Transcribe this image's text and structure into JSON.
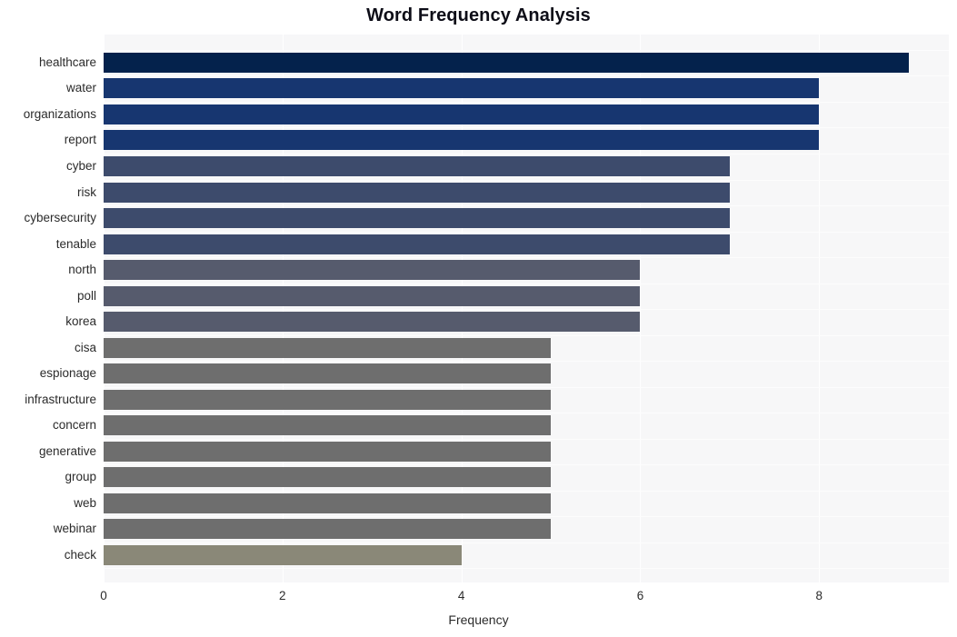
{
  "chart_data": {
    "type": "bar",
    "orientation": "horizontal",
    "title": "Word Frequency Analysis",
    "xlabel": "Frequency",
    "ylabel": "",
    "xlim": [
      0,
      9.45
    ],
    "xticks": [
      0,
      2,
      4,
      6,
      8
    ],
    "xticklabels": [
      "0",
      "2",
      "4",
      "6",
      "8"
    ],
    "grid": "vertical-white-on-light-gray",
    "legend": "none",
    "categories": [
      "healthcare",
      "water",
      "organizations",
      "report",
      "cyber",
      "risk",
      "cybersecurity",
      "tenable",
      "north",
      "poll",
      "korea",
      "cisa",
      "espionage",
      "infrastructure",
      "concern",
      "generative",
      "group",
      "web",
      "webinar",
      "check"
    ],
    "values": [
      9,
      8,
      8,
      8,
      7,
      7,
      7,
      7,
      6,
      6,
      6,
      5,
      5,
      5,
      5,
      5,
      5,
      5,
      5,
      4
    ],
    "bar_colors": [
      "#04224c",
      "#173670",
      "#173670",
      "#173670",
      "#3d4b6c",
      "#3d4b6c",
      "#3d4b6c",
      "#3d4b6c",
      "#565b6d",
      "#565b6d",
      "#565b6d",
      "#6e6e6e",
      "#6e6e6e",
      "#6e6e6e",
      "#6e6e6e",
      "#6e6e6e",
      "#6e6e6e",
      "#6e6e6e",
      "#6e6e6e",
      "#8a8878"
    ],
    "plot_background": "#f7f7f8",
    "figure_background": "#ffffff",
    "title_color": "#0d0d17",
    "tick_color": "#2b2b2b"
  }
}
